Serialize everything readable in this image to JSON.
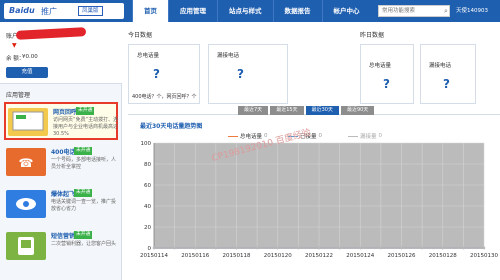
{
  "brand": {
    "main": "Bai",
    "paw": "du",
    "sub": "推广",
    "badge": "凤巢版"
  },
  "nav": {
    "items": [
      "首页",
      "应用管理",
      "站点与样式",
      "数据报告",
      "帐户中心"
    ]
  },
  "search": {
    "placeholder": "常用功能搜索"
  },
  "user": {
    "id": "天使140903"
  },
  "account": {
    "label": "账户：",
    "balance_label": "余 额：",
    "balance_value": "¥0.00",
    "recharge": "充值"
  },
  "apps": {
    "title": "应用管理",
    "items": [
      {
        "name": "网页回呼",
        "badge": "未开通",
        "desc": "访问网页“免费”主动拨打、连接用户与企业电话商机最高达30.5%"
      },
      {
        "name": "400电话",
        "badge": "未开通",
        "desc": "一个号码，多部电话接听，人员分析全掌控"
      },
      {
        "name": "爆体起飞",
        "badge": "未开通",
        "desc": "电话关键词一查一览，推广投放省心省力"
      },
      {
        "name": "短信营销",
        "badge": "未开通",
        "desc": "二次营销利器，让您客户回头"
      }
    ]
  },
  "today": {
    "title": "今日数据",
    "total_calls": "总电话量",
    "missed_calls": "漏接电话",
    "value": "?",
    "note": "400电话？个，网页回呼？个"
  },
  "yesterday": {
    "title": "昨日数据",
    "total_calls": "总电话量",
    "missed_calls": "漏接电话",
    "value": "?"
  },
  "time_tabs": [
    "最近7天",
    "最近15天",
    "最近30天",
    "最近90天"
  ],
  "trend": {
    "title": "最近30天电话量趋势图"
  },
  "watermark": "CP198192010 百度经验",
  "chart_data": {
    "type": "line",
    "series": [
      {
        "name": "总电话量",
        "values": [
          0,
          0,
          0,
          0,
          0,
          0,
          0,
          0,
          0,
          0,
          0,
          0,
          0,
          0,
          0,
          0,
          0
        ]
      },
      {
        "name": "已接量",
        "values": [
          0,
          0,
          0,
          0,
          0,
          0,
          0,
          0,
          0,
          0,
          0,
          0,
          0,
          0,
          0,
          0,
          0
        ]
      },
      {
        "name": "漏接量",
        "values": [
          0,
          0,
          0,
          0,
          0,
          0,
          0,
          0,
          0,
          0,
          0,
          0,
          0,
          0,
          0,
          0,
          0
        ]
      }
    ],
    "x": [
      "20150114",
      "20150115",
      "20150116",
      "20150117",
      "20150118",
      "20150119",
      "20150120",
      "20150121",
      "20150122",
      "20150123",
      "20150124",
      "20150125",
      "20150126",
      "20150127",
      "20150128",
      "20150129",
      "20150130"
    ],
    "x_tick_labels": [
      "20150114",
      "20150116",
      "20150118",
      "20150120",
      "20150122",
      "20150124",
      "20150126",
      "20150128",
      "20150130"
    ],
    "y_ticks": [
      0,
      20,
      40,
      60,
      80,
      100
    ],
    "ylim": [
      0,
      100
    ],
    "series_colors": [
      "#f07b3f",
      "#5a9bd5",
      "#bbbbbb"
    ],
    "series_counts": [
      "0",
      "0",
      "0"
    ]
  },
  "colors": {
    "primary": "#1f5fb0",
    "accent": "#e83a2a",
    "badge": "#3bb14a"
  }
}
